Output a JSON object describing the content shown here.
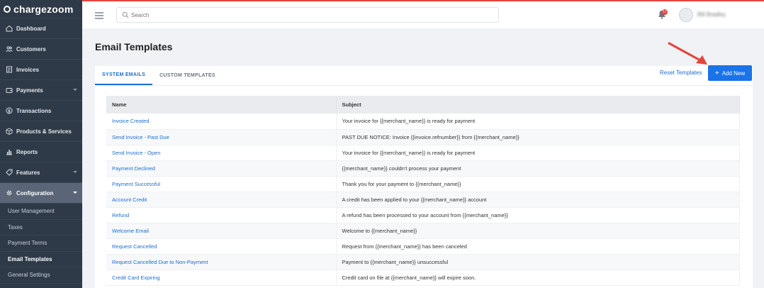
{
  "brand": {
    "name": "chargezoom"
  },
  "sidebar": {
    "items": [
      {
        "label": "Dashboard",
        "icon": "home-icon"
      },
      {
        "label": "Customers",
        "icon": "users-icon"
      },
      {
        "label": "Invoices",
        "icon": "invoice-icon"
      },
      {
        "label": "Payments",
        "icon": "wallet-icon",
        "expandable": true
      },
      {
        "label": "Transactions",
        "icon": "dollar-icon"
      },
      {
        "label": "Products & Services",
        "icon": "box-icon"
      },
      {
        "label": "Reports",
        "icon": "bar-chart-icon"
      },
      {
        "label": "Features",
        "icon": "tag-icon",
        "expandable": true
      },
      {
        "label": "Configuration",
        "icon": "gear-icon",
        "expandable": true,
        "active": true
      }
    ],
    "sub_items": [
      {
        "label": "User Management"
      },
      {
        "label": "Taxes"
      },
      {
        "label": "Payment Terms"
      },
      {
        "label": "Email Templates",
        "active": true
      },
      {
        "label": "General Settings"
      }
    ]
  },
  "topbar": {
    "search_placeholder": "Search",
    "notification_count": "17",
    "user_name": "Bill Bradley"
  },
  "page": {
    "title": "Email Templates",
    "tabs": [
      {
        "label": "SYSTEM EMAILS",
        "active": true
      },
      {
        "label": "CUSTOM TEMPLATES",
        "active": false
      }
    ],
    "reset_label": "Reset Templates",
    "add_label": "Add New"
  },
  "table": {
    "headers": [
      "Name",
      "Subject"
    ],
    "rows": [
      {
        "name": "Invoice Created",
        "subject": "Your invoice for {{merchant_name}} is ready for payment"
      },
      {
        "name": "Send Invoice - Past Due",
        "subject": "PAST DUE NOTICE: Invoice {{invoice.refnumber}} from {{merchant_name}}"
      },
      {
        "name": "Send Invoice - Open",
        "subject": "Your invoice for {{merchant_name}} is ready for payment"
      },
      {
        "name": "Payment Declined",
        "subject": "{{merchant_name}} couldn't process your payment"
      },
      {
        "name": "Payment Successful",
        "subject": "Thank you for your payment to {{merchant_name}}"
      },
      {
        "name": "Account Credit",
        "subject": "A credit has been applied to your {{merchant_name}} account"
      },
      {
        "name": "Refund",
        "subject": "A refund has been processed to your account from {{merchant_name}}"
      },
      {
        "name": "Welcome Email",
        "subject": "Welcome to {{merchant_name}}"
      },
      {
        "name": "Request Cancelled",
        "subject": "Request from {{merchant_name}} has been canceled"
      },
      {
        "name": "Request Cancelled Due to Non-Payment",
        "subject": "Payment to {{merchant_name}} unsuccessful"
      },
      {
        "name": "Credit Card Expiring",
        "subject": "Credit card on file at {{merchant_name}} will expire soon."
      }
    ]
  },
  "colors": {
    "accent": "#1a73e8",
    "sidebar_bg": "#2f3a48",
    "annotation_arrow": "#e4453d"
  }
}
